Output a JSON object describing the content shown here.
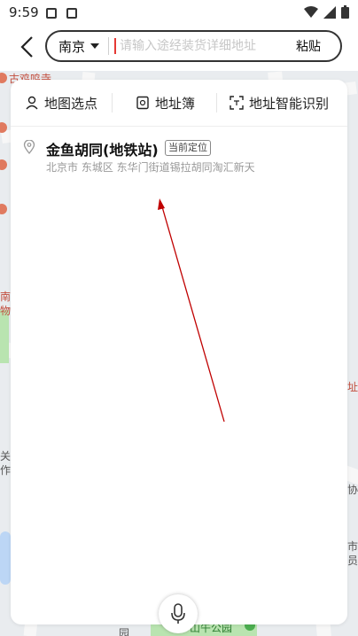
{
  "status_bar": {
    "time": "9:59"
  },
  "header": {
    "city": "南京",
    "search_placeholder": "请输入途经装货详细地址",
    "paste_label": "粘贴"
  },
  "tabs": [
    {
      "label": "地图选点",
      "icon": "map-pin-person-icon"
    },
    {
      "label": "地址簿",
      "icon": "address-book-icon"
    },
    {
      "label": "地址智能识别",
      "icon": "scan-icon"
    }
  ],
  "result": {
    "title": "金鱼胡同(地铁站)",
    "badge": "当前定位",
    "address": "北京市 东城区 东华门街道锡拉胡同淘汇新天"
  },
  "map_labels": {
    "top_left": "古鸡鸣寺",
    "left1": "南",
    "left2": "物",
    "right_mid": "址",
    "left_low1": "关",
    "left_low2": "作",
    "right_low1": "协",
    "right_low2": "市",
    "right_low3": "员",
    "bottom_park": "山午公园",
    "bottom_left": "园"
  },
  "colors": {
    "accent": "#e53935",
    "arrow": "#c00000"
  }
}
